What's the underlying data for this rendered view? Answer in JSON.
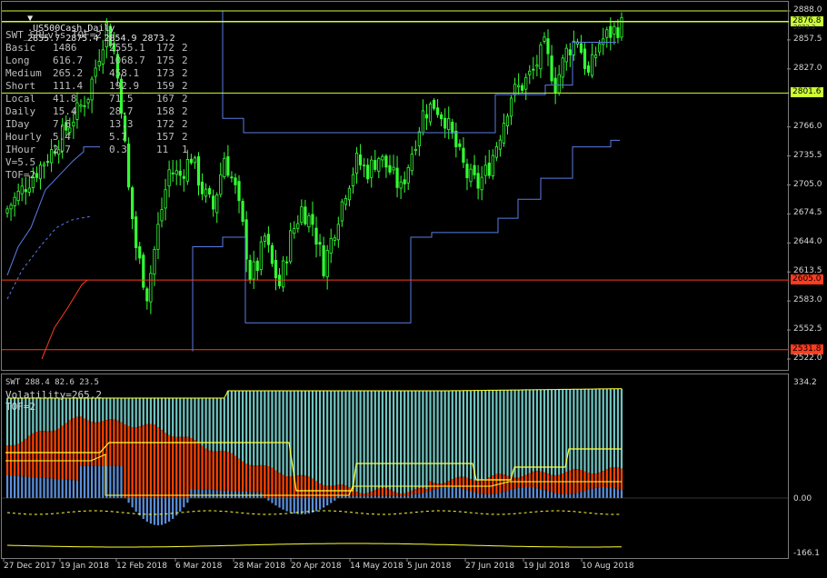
{
  "header": {
    "symbol": ".US500Cash,Daily",
    "ohlc": "2855.7 2875.4 2854.9 2873.2"
  },
  "indicator": {
    "name": "SWT_SRLvls_TOF=2",
    "rows": [
      [
        "Basic",
        "1486",
        "2555.1",
        "172",
        "2"
      ],
      [
        "Long",
        "616.7",
        "1068.7",
        "175",
        "2"
      ],
      [
        "Medium",
        "265.2",
        "458.1",
        "173",
        "2"
      ],
      [
        "Short",
        "111.4",
        "192.9",
        "159",
        "2"
      ],
      [
        "Local",
        "41.8",
        "71.5",
        "167",
        "2"
      ],
      [
        "Daily",
        "15.4",
        "28.7",
        "158",
        "2"
      ],
      [
        "IDay",
        "7.6",
        "13.3",
        "172",
        "2"
      ],
      [
        "Hourly",
        "5.4",
        "5.7",
        "157",
        "2"
      ],
      [
        "IHour",
        "2.7",
        "0.3",
        "11",
        "1"
      ]
    ],
    "v_line": "V=5.5",
    "tof_line": "TOF=2"
  },
  "subwindow": {
    "title": "SWT 288.4 82.6 23.5",
    "volatility": "Volatility=265.2",
    "tof": "TOF=2"
  },
  "price_tags": [
    {
      "value": "2876.8",
      "bg": "#ccff33",
      "fg": "#000000"
    },
    {
      "value": "2801.6",
      "bg": "#ccff33",
      "fg": "#000000"
    },
    {
      "value": "2605.0",
      "bg": "#ff3b1f",
      "fg": "#000000"
    },
    {
      "value": "2531.8",
      "bg": "#ff3b1f",
      "fg": "#000000"
    }
  ],
  "price_axis": [
    "2888.0",
    "2857.5",
    "2827.0",
    "2796.0",
    "2766.0",
    "2735.5",
    "2705.0",
    "2674.5",
    "2644.0",
    "2613.5",
    "2583.0",
    "2552.5",
    "2522.0"
  ],
  "price_axis_hidden": "2873.2",
  "sub_axis": [
    "334.2",
    "0.00",
    "-166.1"
  ],
  "date_axis": [
    "27 Dec 2017",
    "19 Jan 2018",
    "12 Feb 2018",
    "6 Mar 2018",
    "28 Mar 2018",
    "20 Apr 2018",
    "14 May 2018",
    "5 Jun 2018",
    "27 Jun 2018",
    "19 Jul 2018",
    "10 Aug 2018"
  ],
  "colors": {
    "background": "#000000",
    "candles": "#33ff33",
    "sr_line": "#5a7ce6",
    "resistance": "#ccff33",
    "support": "#ff3b1f",
    "hist_orange": "#ff4400",
    "hist_blue": "#5b8fd9",
    "hist_cyan": "#6fc4c0",
    "yellow": "#ffff33"
  }
}
